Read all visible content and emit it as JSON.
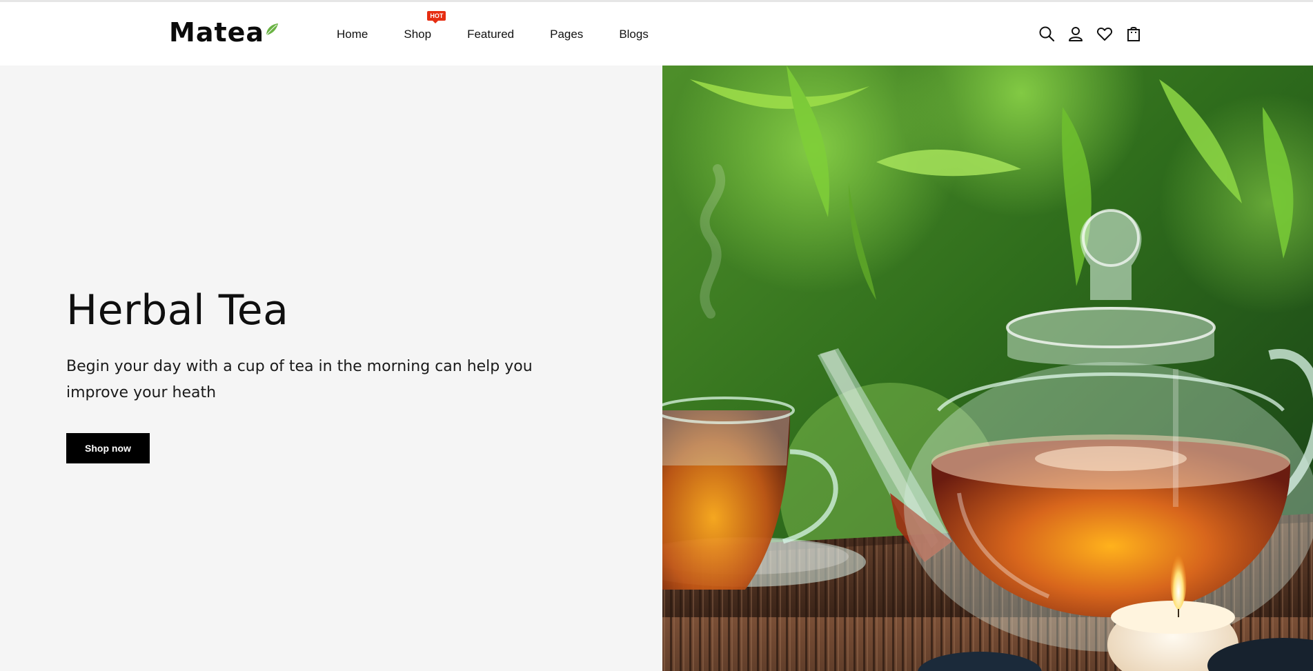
{
  "brand": {
    "name": "Matea"
  },
  "nav": {
    "items": [
      {
        "label": "Home"
      },
      {
        "label": "Shop",
        "badge": "HOT"
      },
      {
        "label": "Featured"
      },
      {
        "label": "Pages"
      },
      {
        "label": "Blogs"
      }
    ]
  },
  "header_icons": [
    "search-icon",
    "user-icon",
    "heart-icon",
    "shopping-bag-icon"
  ],
  "hero": {
    "title": "Herbal Tea",
    "description": "Begin your day with a cup of tea in the morning can help you improve your heath",
    "button_label": "Shop now"
  },
  "colors": {
    "accent_leaf": "#6ab344",
    "badge": "#e62e12",
    "button_bg": "#000000",
    "hero_bg": "#f5f5f5"
  }
}
